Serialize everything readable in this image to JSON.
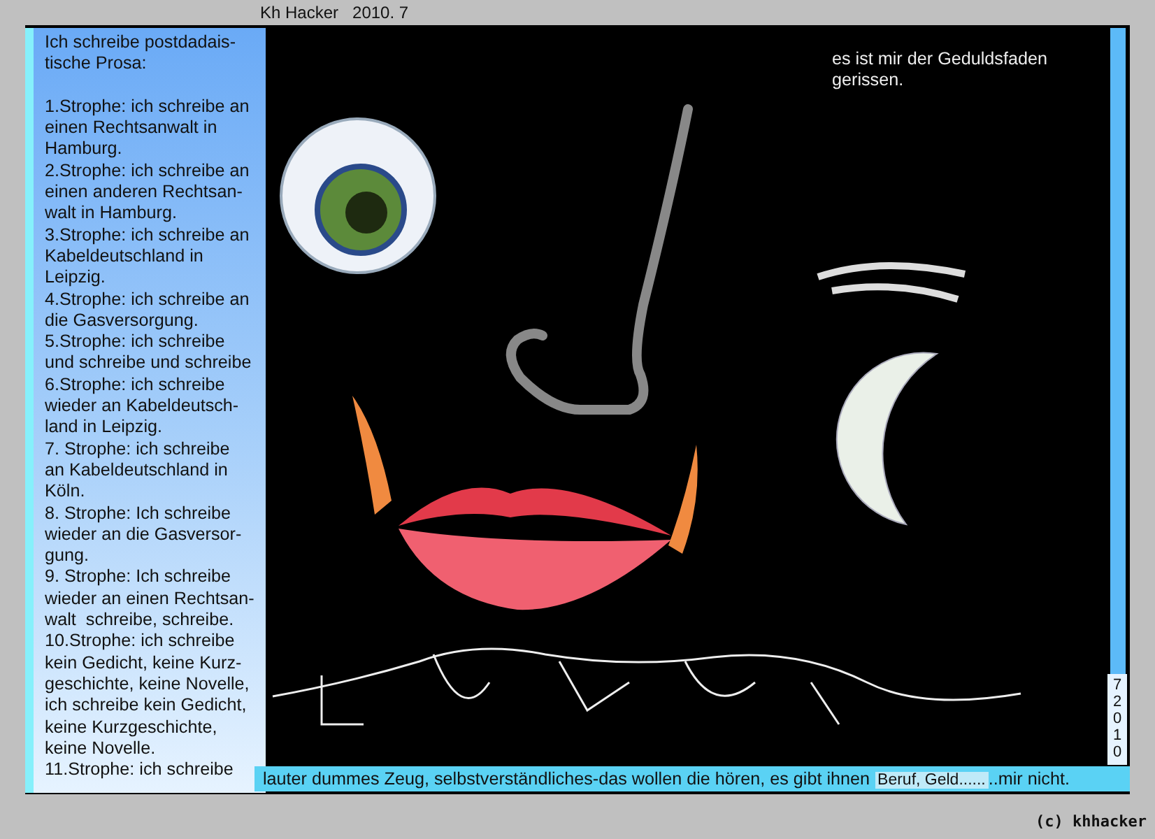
{
  "header": {
    "author": "Kh Hacker",
    "date": "2010. 7"
  },
  "poem": {
    "intro": [
      "Ich schreibe postdadais-",
      "tische Prosa:"
    ],
    "stanzas": [
      [
        "1.Strophe: ich schreibe an",
        "einen Rechtsanwalt in",
        "Hamburg."
      ],
      [
        "2.Strophe: ich schreibe an",
        "einen anderen Rechtsan-",
        "walt in Hamburg."
      ],
      [
        "3.Strophe: ich schreibe an",
        "Kabeldeutschland in",
        "Leipzig."
      ],
      [
        "4.Strophe: ich schreibe an",
        "die Gasversorgung."
      ],
      [
        "5.Strophe: ich schreibe",
        "und schreibe und schreibe"
      ],
      [
        "6.Strophe: ich schreibe",
        "wieder an Kabeldeutsch-",
        "land in Leipzig."
      ],
      [
        "7. Strophe: ich schreibe",
        "an Kabeldeutschland in",
        "Köln."
      ],
      [
        "8. Strophe: Ich schreibe",
        "wieder an die Gasversor-",
        "gung."
      ],
      [
        "9. Strophe: Ich schreibe",
        "wieder an einen Rechtsan-",
        "walt  schreibe, schreibe."
      ],
      [
        "10.Strophe: ich schreibe",
        "kein Gedicht, keine Kurz-",
        "geschichte, keine Novelle,",
        "ich schreibe kein Gedicht,",
        "keine Kurzgeschichte,",
        "keine Novelle."
      ],
      [
        "11.Strophe: ich schreibe"
      ]
    ]
  },
  "caption": [
    "es ist mir der Geduldsfaden",
    "gerissen."
  ],
  "side_date": "72010",
  "bottom_line": {
    "text": "lauter dummes Zeug, selbstverständliches-das wollen die hören, es gibt ihnen",
    "highlight": "Beruf, Geld......",
    "end": "..mir nicht."
  },
  "signature": "(c) khhacker"
}
